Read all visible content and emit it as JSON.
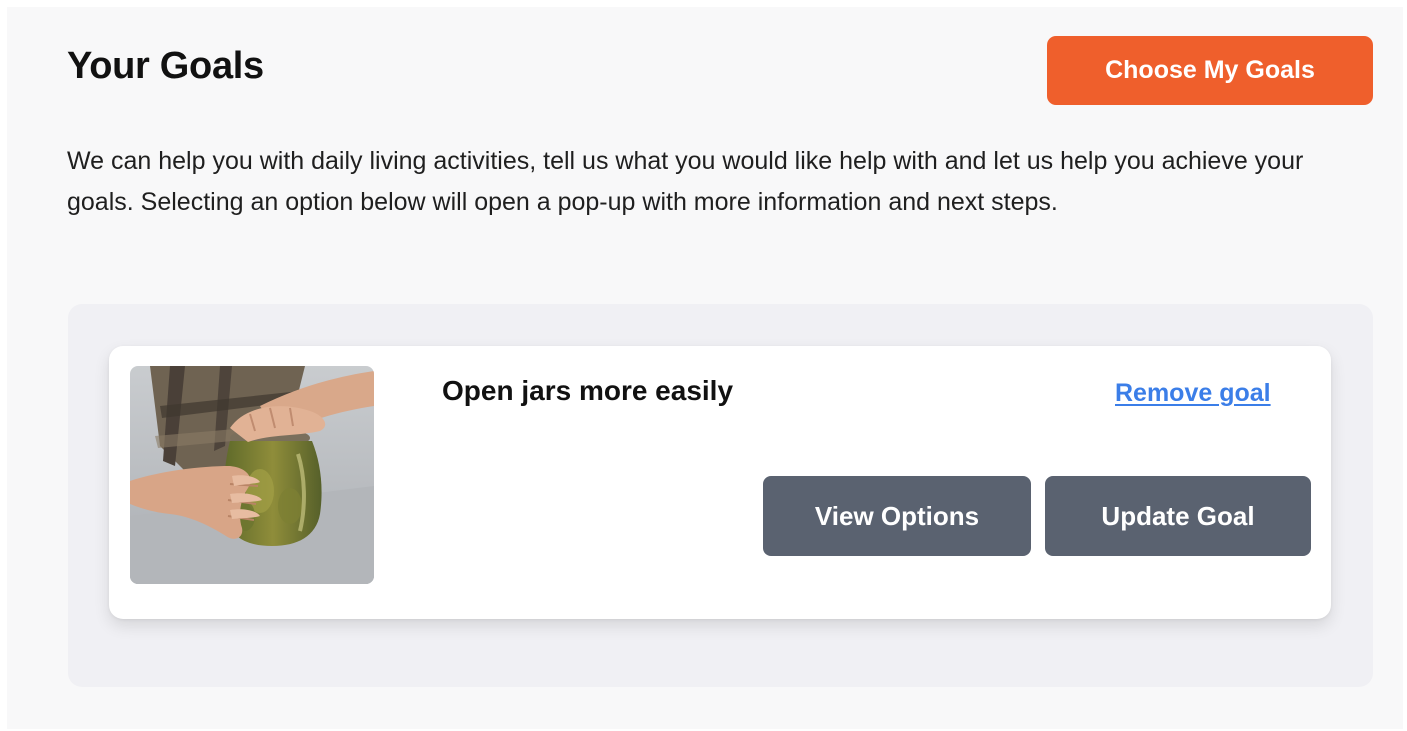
{
  "header": {
    "title": "Your Goals",
    "choose_button_label": "Choose My Goals"
  },
  "description": "We can help you with daily living activities, tell us what you would like help with and let us help you achieve your goals. Selecting an option below will open a pop-up with more information and next steps.",
  "goals": [
    {
      "title": "Open jars more easily",
      "image_icon": "jar-photo",
      "remove_label": "Remove goal",
      "view_options_label": "View Options",
      "update_goal_label": "Update Goal"
    }
  ],
  "colors": {
    "accent": "#ef5f2c",
    "button_secondary": "#5a6270",
    "link": "#3b7ee8",
    "panel_background": "#f8f8f9",
    "container_background": "#f0f0f4"
  }
}
